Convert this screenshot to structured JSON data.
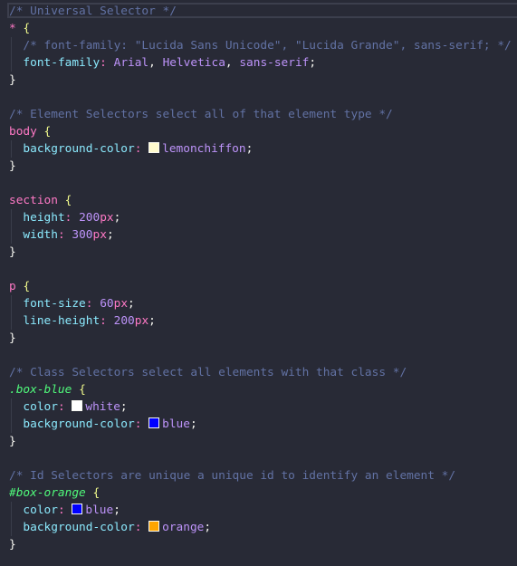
{
  "editor": {
    "language": "css",
    "theme_colors": {
      "background": "#282a36",
      "comment": "#6272a4",
      "element_selector": "#ff79c6",
      "class_selector": "#50fa7b",
      "property": "#8be9fd",
      "value": "#bd93f9"
    },
    "lines": [
      [
        [
          "comment",
          "/* Universal Selector */"
        ]
      ],
      [
        [
          "sel-uni",
          "*"
        ],
        [
          "x",
          " "
        ],
        [
          "brace",
          "{"
        ]
      ],
      [
        [
          "x",
          "  "
        ],
        [
          "comment",
          "/* font-family: \"Lucida Sans Unicode\", \"Lucida Grande\", sans-serif; */"
        ]
      ],
      [
        [
          "x",
          "  "
        ],
        [
          "prop",
          "font-family"
        ],
        [
          "punct",
          ":"
        ],
        [
          "x",
          " "
        ],
        [
          "val",
          "Arial"
        ],
        [
          "semi",
          ", "
        ],
        [
          "val",
          "Helvetica"
        ],
        [
          "semi",
          ", "
        ],
        [
          "val",
          "sans-serif"
        ],
        [
          "semi",
          ";"
        ]
      ],
      [
        [
          "close",
          "}"
        ]
      ],
      [],
      [
        [
          "comment",
          "/* Element Selectors select all of that element type */"
        ]
      ],
      [
        [
          "sel-el",
          "body"
        ],
        [
          "x",
          " "
        ],
        [
          "brace",
          "{"
        ]
      ],
      [
        [
          "x",
          "  "
        ],
        [
          "prop",
          "background-color"
        ],
        [
          "punct",
          ":"
        ],
        [
          "x",
          " "
        ],
        [
          "sw",
          "#fffacd"
        ],
        [
          "val",
          "lemonchiffon"
        ],
        [
          "semi",
          ";"
        ]
      ],
      [
        [
          "close",
          "}"
        ]
      ],
      [],
      [
        [
          "sel-el",
          "section"
        ],
        [
          "x",
          " "
        ],
        [
          "brace",
          "{"
        ]
      ],
      [
        [
          "x",
          "  "
        ],
        [
          "prop",
          "height"
        ],
        [
          "punct",
          ":"
        ],
        [
          "x",
          " "
        ],
        [
          "num",
          "200"
        ],
        [
          "unit",
          "px"
        ],
        [
          "semi",
          ";"
        ]
      ],
      [
        [
          "x",
          "  "
        ],
        [
          "prop",
          "width"
        ],
        [
          "punct",
          ":"
        ],
        [
          "x",
          " "
        ],
        [
          "num",
          "300"
        ],
        [
          "unit",
          "px"
        ],
        [
          "semi",
          ";"
        ]
      ],
      [
        [
          "close",
          "}"
        ]
      ],
      [],
      [
        [
          "sel-el",
          "p"
        ],
        [
          "x",
          " "
        ],
        [
          "brace",
          "{"
        ]
      ],
      [
        [
          "x",
          "  "
        ],
        [
          "prop",
          "font-size"
        ],
        [
          "punct",
          ":"
        ],
        [
          "x",
          " "
        ],
        [
          "num",
          "60"
        ],
        [
          "unit",
          "px"
        ],
        [
          "semi",
          ";"
        ]
      ],
      [
        [
          "x",
          "  "
        ],
        [
          "prop",
          "line-height"
        ],
        [
          "punct",
          ":"
        ],
        [
          "x",
          " "
        ],
        [
          "num",
          "200"
        ],
        [
          "unit",
          "px"
        ],
        [
          "semi",
          ";"
        ]
      ],
      [
        [
          "close",
          "}"
        ]
      ],
      [],
      [
        [
          "comment",
          "/* Class Selectors select all elements with that class */"
        ]
      ],
      [
        [
          "sel-cls",
          ".box-blue"
        ],
        [
          "x",
          " "
        ],
        [
          "brace",
          "{"
        ]
      ],
      [
        [
          "x",
          "  "
        ],
        [
          "prop",
          "color"
        ],
        [
          "punct",
          ":"
        ],
        [
          "x",
          " "
        ],
        [
          "sw",
          "#ffffff"
        ],
        [
          "val",
          "white"
        ],
        [
          "semi",
          ";"
        ]
      ],
      [
        [
          "x",
          "  "
        ],
        [
          "prop",
          "background-color"
        ],
        [
          "punct",
          ":"
        ],
        [
          "x",
          " "
        ],
        [
          "sw",
          "#0000ff"
        ],
        [
          "val",
          "blue"
        ],
        [
          "semi",
          ";"
        ]
      ],
      [
        [
          "close",
          "}"
        ]
      ],
      [],
      [
        [
          "comment",
          "/* Id Selectors are unique a unique id to identify an element */"
        ]
      ],
      [
        [
          "sel-id",
          "#box-orange"
        ],
        [
          "x",
          " "
        ],
        [
          "brace",
          "{"
        ]
      ],
      [
        [
          "x",
          "  "
        ],
        [
          "prop",
          "color"
        ],
        [
          "punct",
          ":"
        ],
        [
          "x",
          " "
        ],
        [
          "sw",
          "#0000ff"
        ],
        [
          "val",
          "blue"
        ],
        [
          "semi",
          ";"
        ]
      ],
      [
        [
          "x",
          "  "
        ],
        [
          "prop",
          "background-color"
        ],
        [
          "punct",
          ":"
        ],
        [
          "x",
          " "
        ],
        [
          "sw",
          "#ffa500"
        ],
        [
          "val",
          "orange"
        ],
        [
          "semi",
          ";"
        ]
      ],
      [
        [
          "close",
          "}"
        ]
      ]
    ]
  }
}
